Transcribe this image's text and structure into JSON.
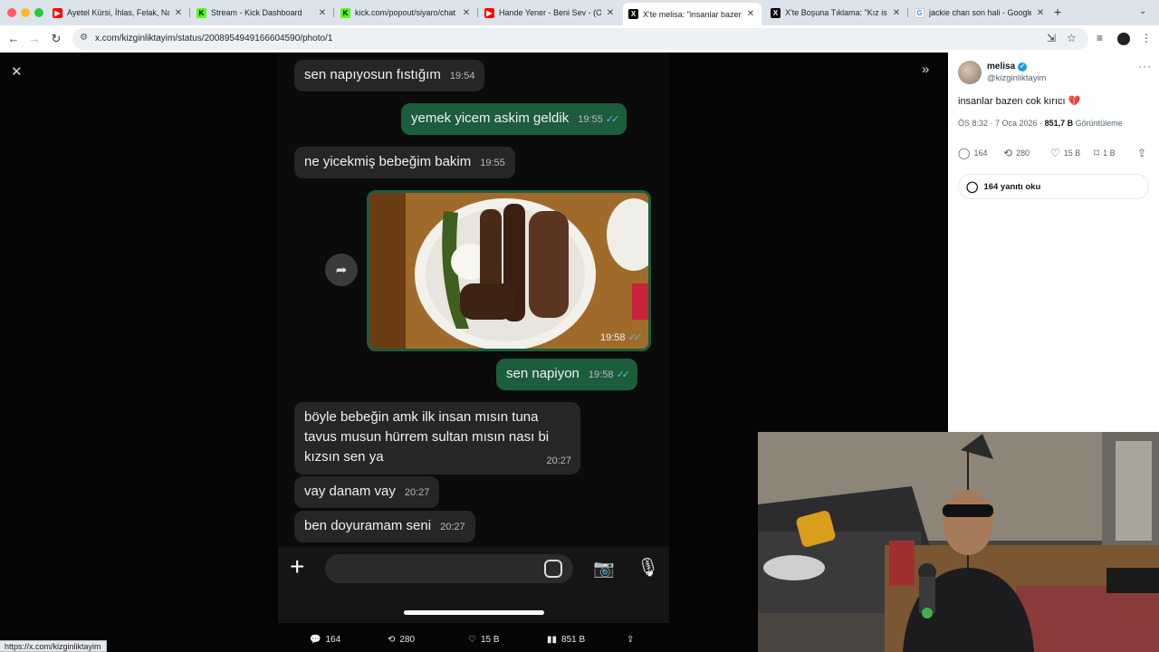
{
  "browser": {
    "tabs": [
      {
        "title": "Ayetel Kürsi, İhlas, Felak, Nas",
        "favicon": "youtube-icon",
        "color": "#ff0000"
      },
      {
        "title": "Stream - Kick Dashboard",
        "favicon": "kick-icon",
        "color": "#53fc18"
      },
      {
        "title": "kick.com/popout/siyaro/chat",
        "favicon": "kick-icon",
        "color": "#53fc18"
      },
      {
        "title": "Hande Yener - Beni Sev - (Offi",
        "favicon": "youtube-icon",
        "color": "#ff0000"
      },
      {
        "title": "X'te melisa: \"insanlar bazen c",
        "favicon": "x-icon",
        "color": "#000000",
        "active": true
      },
      {
        "title": "X'te Boşuna Tıklama: \"Kız iste",
        "favicon": "x-icon",
        "color": "#000000"
      },
      {
        "title": "jackie chan son hali - Google",
        "favicon": "google-icon",
        "color": "#4285f4"
      }
    ],
    "url": "x.com/kizginliktayim/status/2008954949166604590/photo/1",
    "status_url": "https://x.com/kizginliktayim"
  },
  "chat": {
    "messages": [
      {
        "dir": "in",
        "text": "sen napıyosun fıstığım",
        "time": "19:54"
      },
      {
        "dir": "out",
        "text": "yemek yicem askim geldik",
        "time": "19:55",
        "ticks": "✓✓"
      },
      {
        "dir": "in",
        "text": "ne yicekmiş bebeğim bakim",
        "time": "19:55"
      },
      {
        "dir": "photo",
        "time": "19:58",
        "ticks": "✓✓"
      },
      {
        "dir": "out",
        "text": "sen napiyon",
        "time": "19:58",
        "ticks": "✓✓"
      },
      {
        "dir": "in",
        "text": "böyle bebeğin amk ilk insan mısın tuna tavus musun hürrem sultan mısın nası bi kızsın sen ya",
        "time": "20:27"
      },
      {
        "dir": "in",
        "text": "vay danam vay",
        "time": "20:27"
      },
      {
        "dir": "in",
        "text": "ben doyuramam seni",
        "time": "20:27"
      }
    ]
  },
  "viewer_bar": {
    "replies": "164",
    "reposts": "280",
    "likes": "15 B",
    "views": "851 B"
  },
  "tweet": {
    "name": "melisa",
    "handle": "@kizginliktayim",
    "text": "insanlar bazen cok kırıcı 💔",
    "time": "ÖS 8:32 · 7 Oca 2026 · ",
    "views_count": "851,7 B",
    "views_label": " Görüntüleme",
    "replies": "164",
    "reposts": "280",
    "likes": "15 B",
    "bookmarks": "1 B",
    "read_replies": "164 yanıtı oku"
  },
  "colors": {
    "outgoing_bubble": "#1c5d3c",
    "incoming_bubble": "#262626",
    "read_ticks": "#53bdeb",
    "verified": "#1d9bf0"
  }
}
